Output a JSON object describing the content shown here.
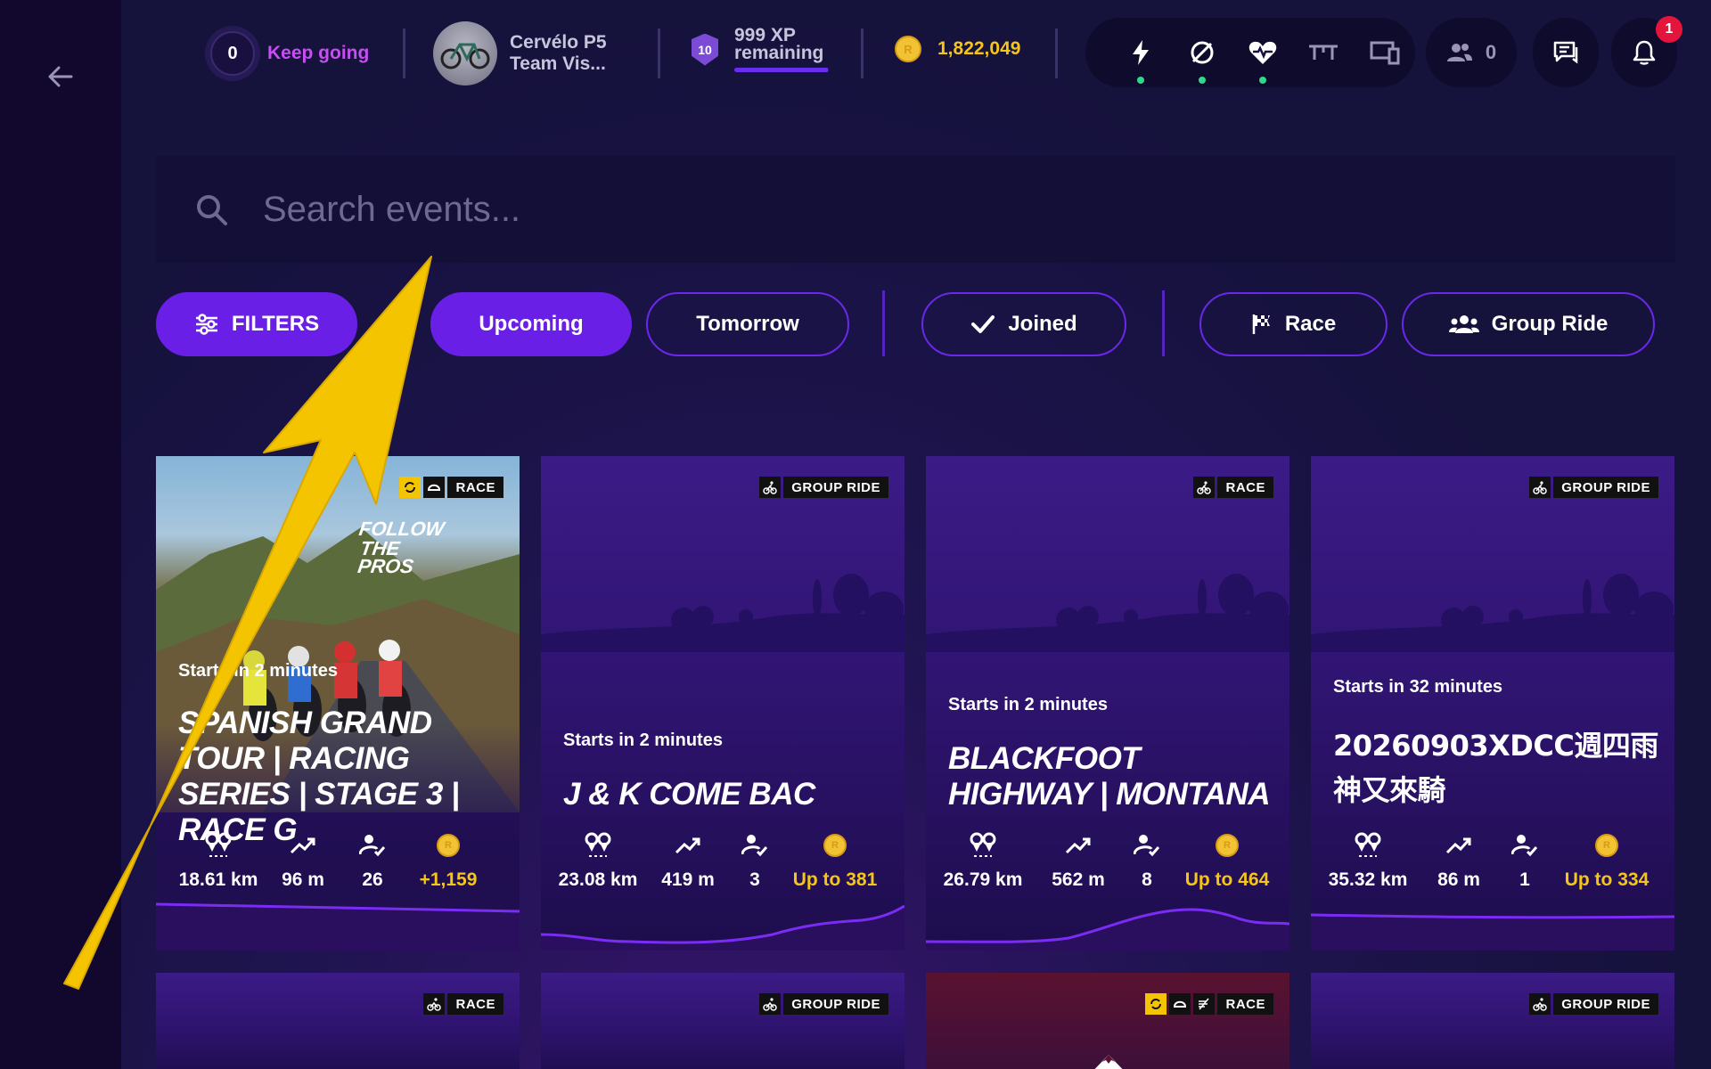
{
  "header": {
    "streak": {
      "count": "0",
      "label": "Keep going"
    },
    "bike": {
      "name_line1": "Cervélo P5",
      "name_line2": "Team Vis..."
    },
    "xp": {
      "level": "10",
      "line1": "999 XP",
      "line2": "remaining",
      "progress": 0.99
    },
    "coins": {
      "symbol": "R",
      "balance": "1,822,049"
    },
    "devices": [
      {
        "icon": "power-icon",
        "connected": true
      },
      {
        "icon": "speed-cadence-icon",
        "connected": true
      },
      {
        "icon": "heart-rate-icon",
        "connected": true
      },
      {
        "icon": "trainer-icon",
        "connected": false
      },
      {
        "icon": "screen-devices-icon",
        "connected": false
      }
    ],
    "friends_count": "0",
    "notifications_count": "1"
  },
  "search": {
    "placeholder": "Search events..."
  },
  "filters": {
    "filters_label": "FILTERS",
    "upcoming": "Upcoming",
    "tomorrow": "Tomorrow",
    "joined": "Joined",
    "race": "Race",
    "group_ride": "Group Ride"
  },
  "events": [
    {
      "type": "RACE",
      "starts": "Starts in 2 minutes",
      "title": "Spanish Grand Tour | Racing Series | Stage 3 | Race G",
      "distance": "18.61 km",
      "elevation": "96 m",
      "participants": "26",
      "reward": "+1,159",
      "image_text_1": "FOLLOW",
      "image_text_2": "THE PROS"
    },
    {
      "type": "GROUP RIDE",
      "starts": "Starts in 2 minutes",
      "title": "J & K COME BAC",
      "distance": "23.08 km",
      "elevation": "419 m",
      "participants": "3",
      "reward": "Up to 381"
    },
    {
      "type": "RACE",
      "starts": "Starts in 2 minutes",
      "title": "Blackfoot Highway | Montana",
      "distance": "26.79 km",
      "elevation": "562 m",
      "participants": "8",
      "reward": "Up to 464"
    },
    {
      "type": "GROUP RIDE",
      "starts": "Starts in 32 minutes",
      "title": "20260903XDCC週四雨神又來騎",
      "distance": "35.32 km",
      "elevation": "86 m",
      "participants": "1",
      "reward": "Up to 334"
    }
  ],
  "next_row_tags": [
    "RACE",
    "GROUP RIDE",
    "RACE",
    "GROUP RIDE"
  ],
  "colors": {
    "accent": "#6a1fe6",
    "gold": "#f5c518",
    "streak": "#c94cf4",
    "connected": "#2fd88a",
    "badge": "#e4143c",
    "annotation_arrow": "#f5c400"
  }
}
